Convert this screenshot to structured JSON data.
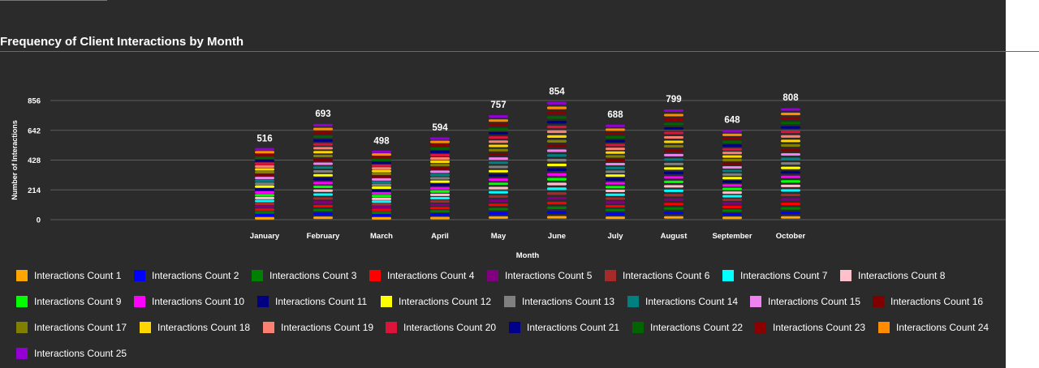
{
  "title": "Frequency of Client Interactions by Month",
  "chart_data": {
    "type": "bar",
    "stacked": true,
    "title": "Frequency of Client Interactions by Month",
    "xlabel": "Month",
    "ylabel": "Number of Interactions",
    "ylim": [
      0,
      856
    ],
    "yticks": [
      0,
      214,
      428,
      642,
      856
    ],
    "grid": true,
    "legend_position": "bottom",
    "categories": [
      "January",
      "February",
      "March",
      "April",
      "May",
      "June",
      "July",
      "August",
      "September",
      "October"
    ],
    "totals": [
      516,
      693,
      498,
      594,
      757,
      854,
      688,
      799,
      648,
      808
    ],
    "series_count": 25,
    "series": [
      {
        "name": "Interactions Count 1",
        "color": "#ffa500"
      },
      {
        "name": "Interactions Count 2",
        "color": "#0000ff"
      },
      {
        "name": "Interactions Count 3",
        "color": "#008000"
      },
      {
        "name": "Interactions Count 4",
        "color": "#ff0000"
      },
      {
        "name": "Interactions Count 5",
        "color": "#800080"
      },
      {
        "name": "Interactions Count 6",
        "color": "#a52a2a"
      },
      {
        "name": "Interactions Count 7",
        "color": "#00ffff"
      },
      {
        "name": "Interactions Count 8",
        "color": "#ffc0cb"
      },
      {
        "name": "Interactions Count 9",
        "color": "#00ff00"
      },
      {
        "name": "Interactions Count 10",
        "color": "#ff00ff"
      },
      {
        "name": "Interactions Count 11",
        "color": "#000080"
      },
      {
        "name": "Interactions Count 12",
        "color": "#ffff00"
      },
      {
        "name": "Interactions Count 13",
        "color": "#808080"
      },
      {
        "name": "Interactions Count 14",
        "color": "#008080"
      },
      {
        "name": "Interactions Count 15",
        "color": "#ee82ee"
      },
      {
        "name": "Interactions Count 16",
        "color": "#800000"
      },
      {
        "name": "Interactions Count 17",
        "color": "#808000"
      },
      {
        "name": "Interactions Count 18",
        "color": "#ffd700"
      },
      {
        "name": "Interactions Count 19",
        "color": "#fa8072"
      },
      {
        "name": "Interactions Count 20",
        "color": "#dc143c"
      },
      {
        "name": "Interactions Count 21",
        "color": "#00008b"
      },
      {
        "name": "Interactions Count 22",
        "color": "#006400"
      },
      {
        "name": "Interactions Count 23",
        "color": "#8b0000"
      },
      {
        "name": "Interactions Count 24",
        "color": "#ff8c00"
      },
      {
        "name": "Interactions Count 25",
        "color": "#9400d3"
      }
    ]
  }
}
